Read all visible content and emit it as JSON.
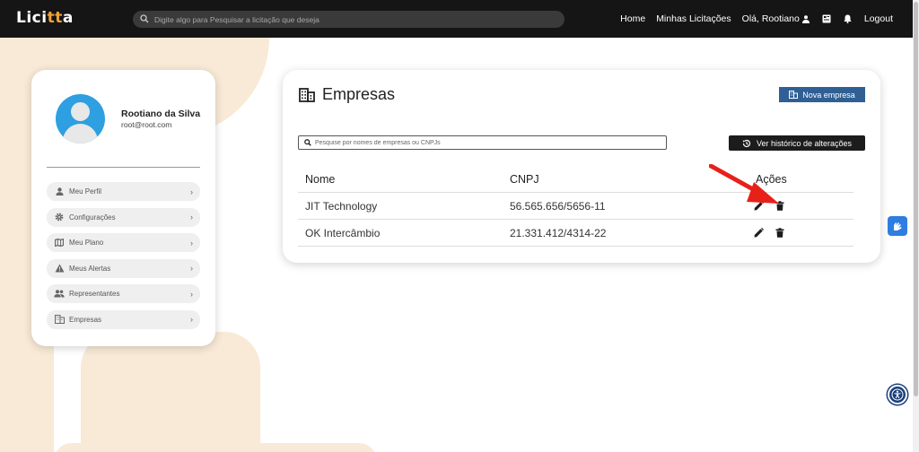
{
  "app": {
    "logo_prefix": "Lici",
    "logo_accent": "tt",
    "logo_suffix": "a",
    "accent_color": "#f1a33b",
    "search_placeholder": "Digite algo para Pesquisar a licitação que deseja"
  },
  "nav": {
    "home": "Home",
    "minhas_licitacoes": "Minhas Licitações",
    "greeting": "Olá, Rootiano",
    "icons": [
      "user-icon",
      "dashboard-icon",
      "bell-icon"
    ],
    "logout": "Logout"
  },
  "profile": {
    "name": "Rootiano da Silva",
    "email": "root@root.com",
    "menu": [
      {
        "label": "Meu Perfil",
        "icon": "person-icon"
      },
      {
        "label": "Configurações",
        "icon": "gear-icon"
      },
      {
        "label": "Meu Plano",
        "icon": "map-icon"
      },
      {
        "label": "Meus Alertas",
        "icon": "warning-icon"
      },
      {
        "label": "Representantes",
        "icon": "people-icon"
      },
      {
        "label": "Empresas",
        "icon": "building-icon"
      }
    ]
  },
  "empresas": {
    "title": "Empresas",
    "new_button": "Nova empresa",
    "search_placeholder": "Pesquise por nomes de empresas ou CNPJs",
    "history_button": "Ver histórico de alterações",
    "columns": {
      "nome": "Nome",
      "cnpj": "CNPJ",
      "acoes": "Ações"
    },
    "rows": [
      {
        "nome": "JIT Technology",
        "cnpj": "56.565.656/5656-11"
      },
      {
        "nome": "OK Intercâmbio",
        "cnpj": "21.331.412/4314-22"
      }
    ]
  },
  "colors": {
    "primary_button": "#2f5f95",
    "dark_button": "#1c1c1c",
    "highlight_arrow": "#e8201a",
    "background_shape": "#f8ead6"
  }
}
